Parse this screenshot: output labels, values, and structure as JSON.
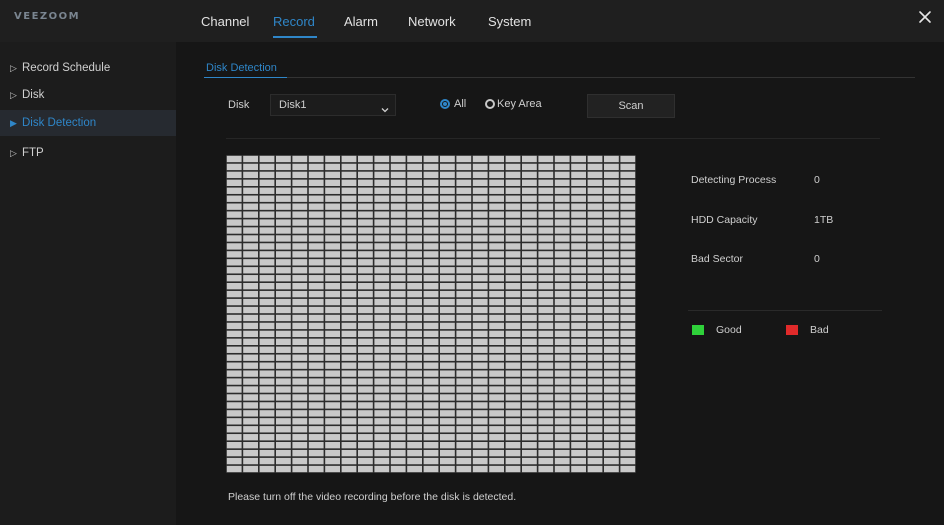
{
  "app": {
    "logo": "VEEZOOM"
  },
  "nav": {
    "tabs": [
      {
        "label": "Channel"
      },
      {
        "label": "Record"
      },
      {
        "label": "Alarm"
      },
      {
        "label": "Network"
      },
      {
        "label": "System"
      }
    ],
    "active_tab": "Record",
    "close_icon": "close-icon"
  },
  "sidebar": {
    "items": [
      {
        "label": "Record Schedule"
      },
      {
        "label": "Disk"
      },
      {
        "label": "Disk Detection"
      },
      {
        "label": "FTP"
      }
    ],
    "active_item": "Disk Detection"
  },
  "main": {
    "subtab": "Disk Detection",
    "disk_label": "Disk",
    "disk_value": "Disk1",
    "radio_all": "All",
    "radio_key_area": "Key Area",
    "scan_button": "Scan",
    "stats": {
      "detecting_process_label": "Detecting Process",
      "detecting_process_value": "0",
      "hdd_capacity_label": "HDD Capacity",
      "hdd_capacity_value": "1TB",
      "bad_sector_label": "Bad Sector",
      "bad_sector_value": "0"
    },
    "legend": {
      "good_label": "Good",
      "bad_label": "Bad",
      "good_color": "#2fd13a",
      "bad_color": "#e02a2a"
    },
    "note": "Please turn off the video recording before the disk is detected."
  },
  "colors": {
    "accent": "#2f86c8",
    "background": "#161616",
    "grid_cell": "#c9c9c9"
  }
}
